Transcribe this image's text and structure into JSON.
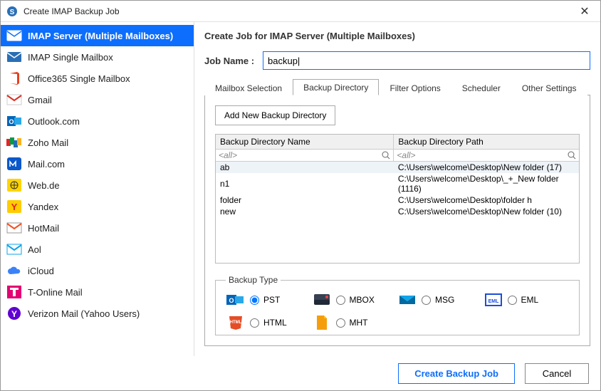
{
  "window": {
    "title": "Create IMAP Backup Job"
  },
  "sidebar": {
    "items": [
      {
        "label": "IMAP Server (Multiple Mailboxes)"
      },
      {
        "label": "IMAP Single Mailbox"
      },
      {
        "label": "Office365 Single Mailbox"
      },
      {
        "label": "Gmail"
      },
      {
        "label": "Outlook.com"
      },
      {
        "label": "Zoho Mail"
      },
      {
        "label": "Mail.com"
      },
      {
        "label": "Web.de"
      },
      {
        "label": "Yandex"
      },
      {
        "label": "HotMail"
      },
      {
        "label": "Aol"
      },
      {
        "label": "iCloud"
      },
      {
        "label": "T-Online Mail"
      },
      {
        "label": "Verizon Mail (Yahoo Users)"
      }
    ]
  },
  "main": {
    "heading": "Create Job for IMAP Server (Multiple Mailboxes)",
    "job_name_label": "Job Name :",
    "job_name_value": "backup|",
    "tabs": [
      {
        "label": "Mailbox Selection"
      },
      {
        "label": "Backup Directory"
      },
      {
        "label": "Filter Options"
      },
      {
        "label": "Scheduler"
      },
      {
        "label": "Other Settings"
      }
    ],
    "add_dir_btn": "Add New Backup Directory",
    "grid": {
      "col1": "Backup Directory Name",
      "col2": "Backup Directory Path",
      "filter_placeholder": "<all>",
      "rows": [
        {
          "name": "ab",
          "path": "C:\\Users\\welcome\\Desktop\\New folder (17)"
        },
        {
          "name": "n1",
          "path": "C:\\Users\\welcome\\Desktop\\_+_New folder (1116)"
        },
        {
          "name": "folder",
          "path": "C:\\Users\\welcome\\Desktop\\folder h"
        },
        {
          "name": "new",
          "path": "C:\\Users\\welcome\\Desktop\\New folder (10)"
        }
      ]
    },
    "backup_type": {
      "legend": "Backup Type",
      "options": [
        {
          "label": "PST"
        },
        {
          "label": "MBOX"
        },
        {
          "label": "MSG"
        },
        {
          "label": "EML"
        },
        {
          "label": "HTML"
        },
        {
          "label": "MHT"
        }
      ]
    }
  },
  "footer": {
    "create": "Create Backup Job",
    "cancel": "Cancel"
  }
}
